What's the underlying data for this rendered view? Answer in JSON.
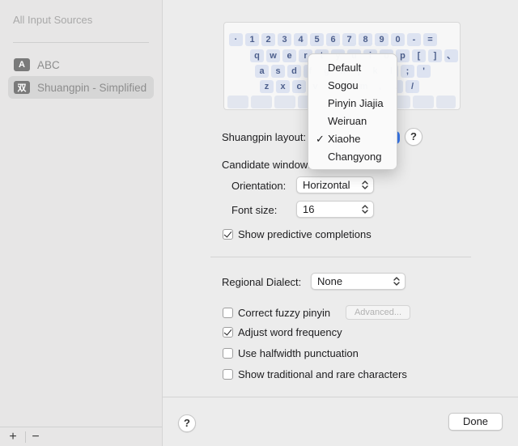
{
  "sidebar": {
    "header": "All Input Sources",
    "items": [
      {
        "badge": "A",
        "label": "ABC",
        "selected": false
      },
      {
        "badge": "双",
        "label": "Shuangpin - Simplified",
        "selected": true
      }
    ],
    "add_label": "+",
    "remove_label": "−"
  },
  "keyboard": {
    "rows": [
      [
        "·",
        "1",
        "2",
        "3",
        "4",
        "5",
        "6",
        "7",
        "8",
        "9",
        "0",
        "-",
        "="
      ],
      [
        "q",
        "w",
        "e",
        "r",
        "t",
        "y",
        "u",
        "i",
        "o",
        "p",
        "[",
        "]",
        "、"
      ],
      [
        "a",
        "s",
        "d",
        "f",
        "g",
        "h",
        "j",
        "k",
        "l",
        ";",
        "'"
      ],
      [
        "z",
        "x",
        "c",
        "v",
        "b",
        "n",
        "m",
        ",",
        ".",
        "/"
      ]
    ]
  },
  "layout": {
    "label": "Shuangpin layout:",
    "help": "?"
  },
  "candidate": {
    "label": "Candidate window:",
    "orientation_label": "Orientation:",
    "orientation_value": "Horizontal",
    "font_size_label": "Font size:",
    "font_size_value": "16",
    "predictive_label": "Show predictive completions",
    "predictive_checked": true
  },
  "dialect": {
    "label": "Regional Dialect:",
    "value": "None"
  },
  "options": {
    "fuzzy_label": "Correct fuzzy pinyin",
    "fuzzy_checked": false,
    "advanced_label": "Advanced...",
    "adjust_label": "Adjust word frequency",
    "adjust_checked": true,
    "halfwidth_label": "Use halfwidth punctuation",
    "halfwidth_checked": false,
    "traditional_label": "Show traditional and rare characters",
    "traditional_checked": false
  },
  "footer": {
    "help": "?",
    "done_label": "Done"
  },
  "menu": {
    "items": [
      {
        "label": "Default",
        "checked": false
      },
      {
        "label": "Sogou",
        "checked": false
      },
      {
        "label": "Pinyin Jiajia",
        "checked": false
      },
      {
        "label": "Weiruan",
        "checked": false
      },
      {
        "label": "Xiaohe",
        "checked": true
      },
      {
        "label": "Changyong",
        "checked": false
      }
    ],
    "check_glyph": "✓"
  },
  "colors": {
    "accent": "#3a7bf1",
    "key_fill": "#dde3f1",
    "key_text": "#4d5f8c"
  }
}
